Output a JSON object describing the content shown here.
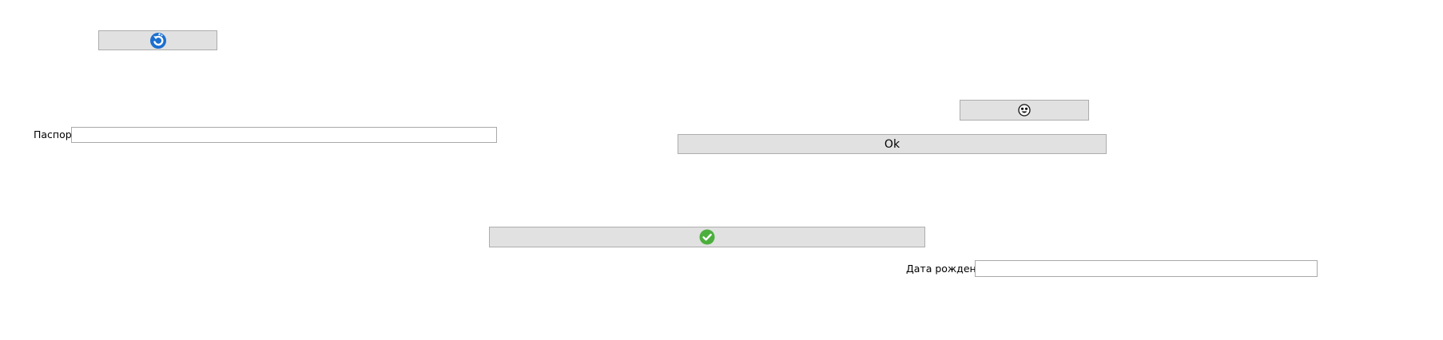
{
  "buttons": {
    "refresh": {
      "icon": "refresh-icon",
      "label": ""
    },
    "smiley": {
      "icon": "smiley-icon",
      "label": ""
    },
    "ok": {
      "label": "Ok"
    },
    "confirm": {
      "icon": "check-circle-icon",
      "label": ""
    }
  },
  "fields": {
    "passport": {
      "label": "Паспорт",
      "value": "",
      "placeholder": ""
    },
    "birth_date": {
      "label": "Дата рождения",
      "value": "",
      "placeholder": ""
    }
  },
  "colors": {
    "button_face": "#e1e1e1",
    "button_border": "#adadad",
    "refresh_icon": "#1c6fcf",
    "check_icon": "#4caf3d"
  }
}
